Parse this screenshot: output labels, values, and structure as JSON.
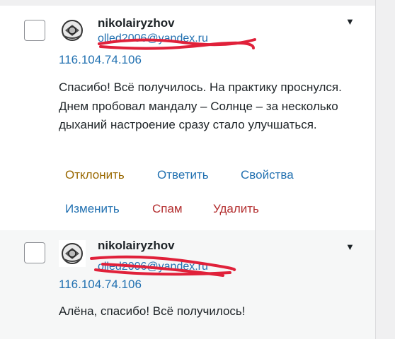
{
  "comments": [
    {
      "author": "nikolairyzhov",
      "email": "olled2006@yandex.ru",
      "ip": "116.104.74.106",
      "text": "Спасибо! Всё получилось. На практику проснулся. Днем пробовал мандалу – Солнце – за несколько дыханий настроение сразу стало улучшаться.",
      "actions": {
        "reject": "Отклонить",
        "reply": "Ответить",
        "properties": "Свойства",
        "edit": "Изменить",
        "spam": "Спам",
        "delete": "Удалить"
      }
    },
    {
      "author": "nikolairyzhov",
      "email": "olled2006@yandex.ru",
      "ip": "116.104.74.106",
      "text": "Алёна, спасибо! Всё получилось!"
    }
  ],
  "colors": {
    "link": "#2271b1",
    "reject": "#996800",
    "danger": "#b32d2e",
    "redaction": "#e0213a"
  },
  "icons": [
    "avatar-icon",
    "row-toggle-caret-icon"
  ]
}
